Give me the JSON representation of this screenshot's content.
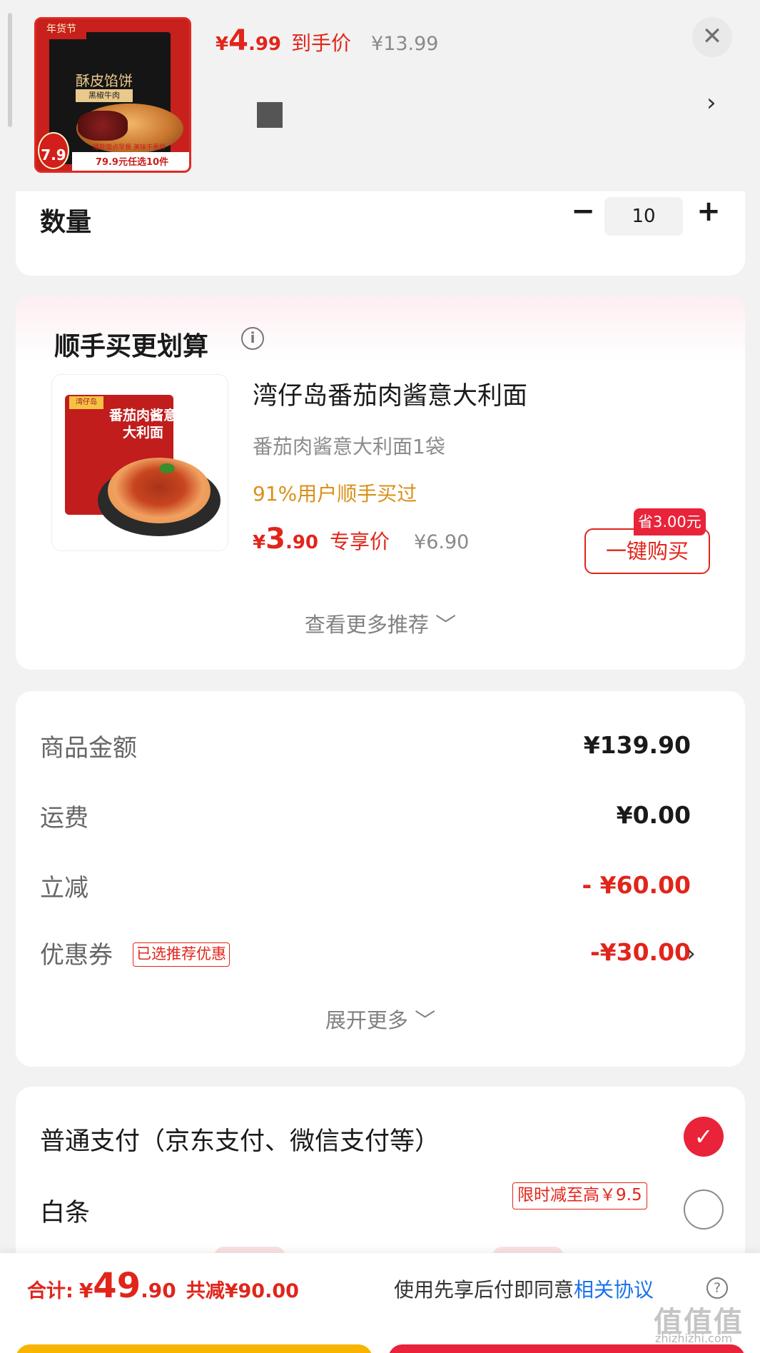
{
  "product": {
    "thumb_tag": "年货节",
    "thumb_title": "酥皮馅饼",
    "thumb_sub": "黑椒牛肉",
    "thumb_badge_label": "参考价",
    "thumb_badge_value": "7.9",
    "thumb_ribbon_small": "爆款面点早餐 美味不重样",
    "thumb_ribbon": "79.9元任选10件",
    "currency": "¥",
    "price_int": "4",
    "price_dec": ".99",
    "price_tag": "到手价",
    "orig_price": "¥13.99"
  },
  "quantity": {
    "label": "数量",
    "minus": "−",
    "value": "10",
    "plus": "+"
  },
  "recommend": {
    "title": "顺手买更划算",
    "thumb_brand": "湾仔岛",
    "thumb_text": "番茄肉酱意大利面",
    "name": "湾仔岛番茄肉酱意大利面",
    "spec": "番茄肉酱意大利面1袋",
    "rate": "91%用户顺手买过",
    "currency": "¥",
    "price_int": "3",
    "price_dec": ".90",
    "price_tag": "专享价",
    "orig_price": "¥6.90",
    "save_badge": "省3.00元",
    "buy_button": "一键购买",
    "see_more": "查看更多推荐 ﹀"
  },
  "summary": {
    "rows": [
      {
        "label": "商品金额",
        "value": "¥139.90"
      },
      {
        "label": "运费",
        "value": "¥0.00"
      },
      {
        "label": "立减",
        "value": "- ¥60.00"
      },
      {
        "label": "优惠券",
        "value": "-¥30.00",
        "tag": "已选推荐优惠"
      }
    ],
    "expand_more": "展开更多 ﹀"
  },
  "payment": {
    "options": [
      {
        "label": "普通支付（京东支付、微信支付等）",
        "selected": true
      },
      {
        "label": "白条",
        "selected": false,
        "tag": "限时减至高￥9.5"
      }
    ]
  },
  "bottom": {
    "total_label": "合计:",
    "currency": "¥",
    "total_int": "49",
    "total_dec": ".90",
    "discount": "共减¥90.00",
    "agree_text": "使用先享后付即同意",
    "agree_link": "相关协议",
    "watermark": "值值值",
    "watermark_sub": "zhizhizhi.com"
  },
  "colors": {
    "accent": "#e1251b",
    "badge": "#e8233a",
    "rate": "#d9901a",
    "link": "#1a73e8"
  }
}
